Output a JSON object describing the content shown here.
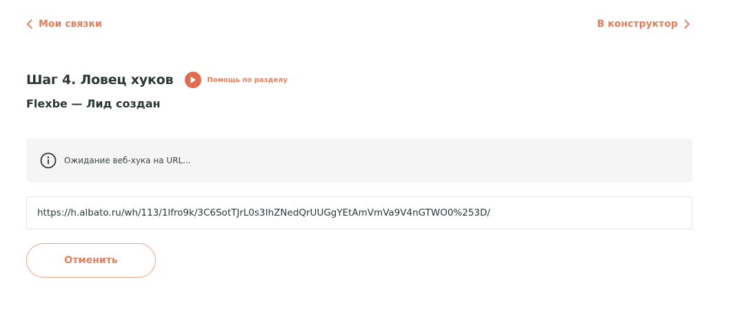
{
  "nav": {
    "back_label": "Мои связки",
    "forward_label": "В конструктор"
  },
  "step": {
    "title": "Шаг 4. Ловец хуков",
    "help_label": "Помощь по разделу",
    "subtitle": "Flexbe — Лид создан"
  },
  "info": {
    "icon": "info-icon",
    "message": "Ожидание веб-хука на URL..."
  },
  "webhook": {
    "url": "https://h.albato.ru/wh/113/1lfro9k/3C6SotTJrL0s3IhZNedQrUUGgYEtAmVmVa9V4nGTWO0%253D/"
  },
  "actions": {
    "cancel_label": "Отменить"
  },
  "colors": {
    "accent": "#e07f5e",
    "play_button": "#e06c4f",
    "text_dark": "#2b3536",
    "info_bg": "#f5f5f5"
  }
}
